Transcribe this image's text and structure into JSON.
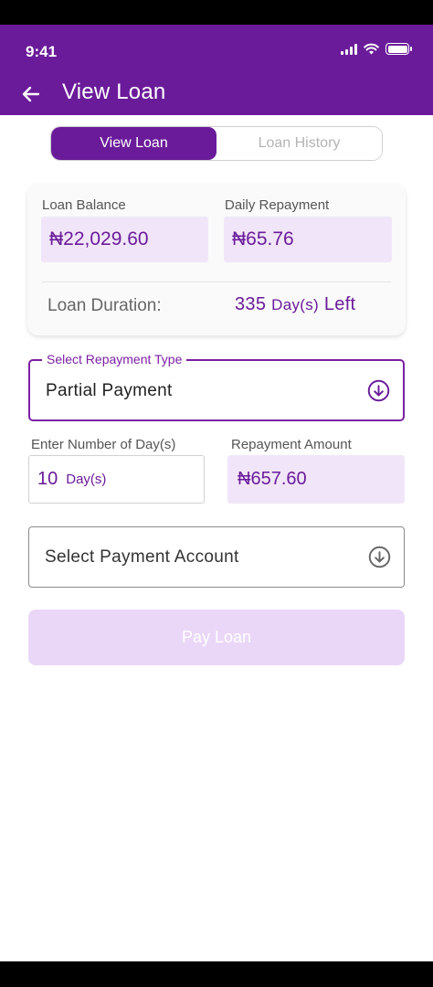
{
  "status_bar": {
    "time": "9:41"
  },
  "header": {
    "title": "View Loan"
  },
  "tabs": [
    {
      "label": "View Loan",
      "active": true
    },
    {
      "label": "Loan History",
      "active": false
    }
  ],
  "summary": {
    "loan_balance_label": "Loan Balance",
    "loan_balance_value": "₦22,029.60",
    "daily_repayment_label": "Daily Repayment",
    "daily_repayment_value": "₦65.76",
    "duration_label": "Loan Duration:",
    "duration_days": "335",
    "duration_unit": "Day(s)",
    "duration_suffix": "Left"
  },
  "repayment_type": {
    "legend": "Select Repayment Type",
    "value": "Partial Payment",
    "icon": "circle-arrow-down-icon"
  },
  "days_field": {
    "label": "Enter Number of Day(s)",
    "value": "10",
    "unit": "Day(s)"
  },
  "amount_field": {
    "label": "Repayment Amount",
    "value": "₦657.60"
  },
  "payment_account": {
    "placeholder": "Select Payment Account",
    "icon": "circle-arrow-down-icon"
  },
  "pay_button": {
    "label": "Pay Loan",
    "enabled": false
  },
  "colors": {
    "primary": "#6a1b9a",
    "light_fill": "#f1e6f9",
    "disabled_button": "#ead7f8"
  }
}
